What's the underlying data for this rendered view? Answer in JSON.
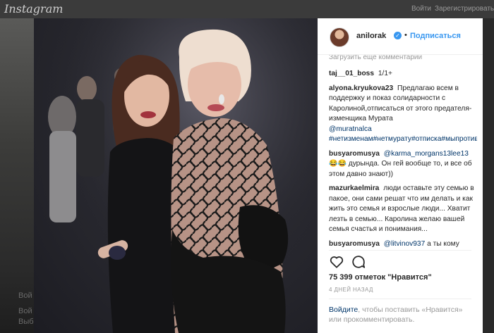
{
  "page": {
    "background_header": {
      "logo": "Instagram",
      "nav_login": "Войти",
      "nav_signup": "Зарегистрироваться"
    },
    "left_ghost": [
      "Вой",
      "Вой",
      "Выб"
    ]
  },
  "post": {
    "photo_alt": "Две женщины на вечеринке",
    "header": {
      "username": "anilorak",
      "verified_icon": "verified-badge-icon",
      "separator": "•",
      "follow_label": "Подписаться"
    },
    "load_more_comments": "Загрузить еще комментарии",
    "comments": [
      {
        "author": "taj__01_boss",
        "text": "1/1+"
      },
      {
        "author": "alyona.kryukova23",
        "text": "Предлагаю всем в поддержку и показ солидарности с Каролиной,отписаться от этого предателя-изменщика Мурата",
        "mention": "@muratnalca",
        "tags": "#нетизменам#нетмурату#отписка#мыпротивизмены#хватитлжи#мыскаролиной#анилорак#мыстобой"
      },
      {
        "author": "busyaromusya",
        "mention": "@karma_morgans13lee13",
        "emoji": "😂😂",
        "text": "дурында. Он гей вообще то, и все об этом давно знают))"
      },
      {
        "author": "mazurkaelmira",
        "text": "люди оставьте эту семью в пакое, они сами решат что им делать и как жить это семья и взрослые люди... Хватит лезть в семью... Каролина желаю вашей семья счастья и понимания..."
      },
      {
        "author": "busyaromusya",
        "mention": "@litvinov937",
        "text": "а ты кому"
      }
    ],
    "actions": {
      "like_icon": "heart-icon",
      "comment_icon": "comment-icon"
    },
    "likes": "75 399 отметок \"Нравится\"",
    "date": "4 ДНЕЙ НАЗАД",
    "login_prompt": {
      "link": "Войдите",
      "text": ", чтобы поставить «Нравится» или прокомментировать."
    }
  },
  "colors": {
    "accent": "#3897f0",
    "link": "#003569",
    "muted": "#999999",
    "text": "#262626"
  }
}
